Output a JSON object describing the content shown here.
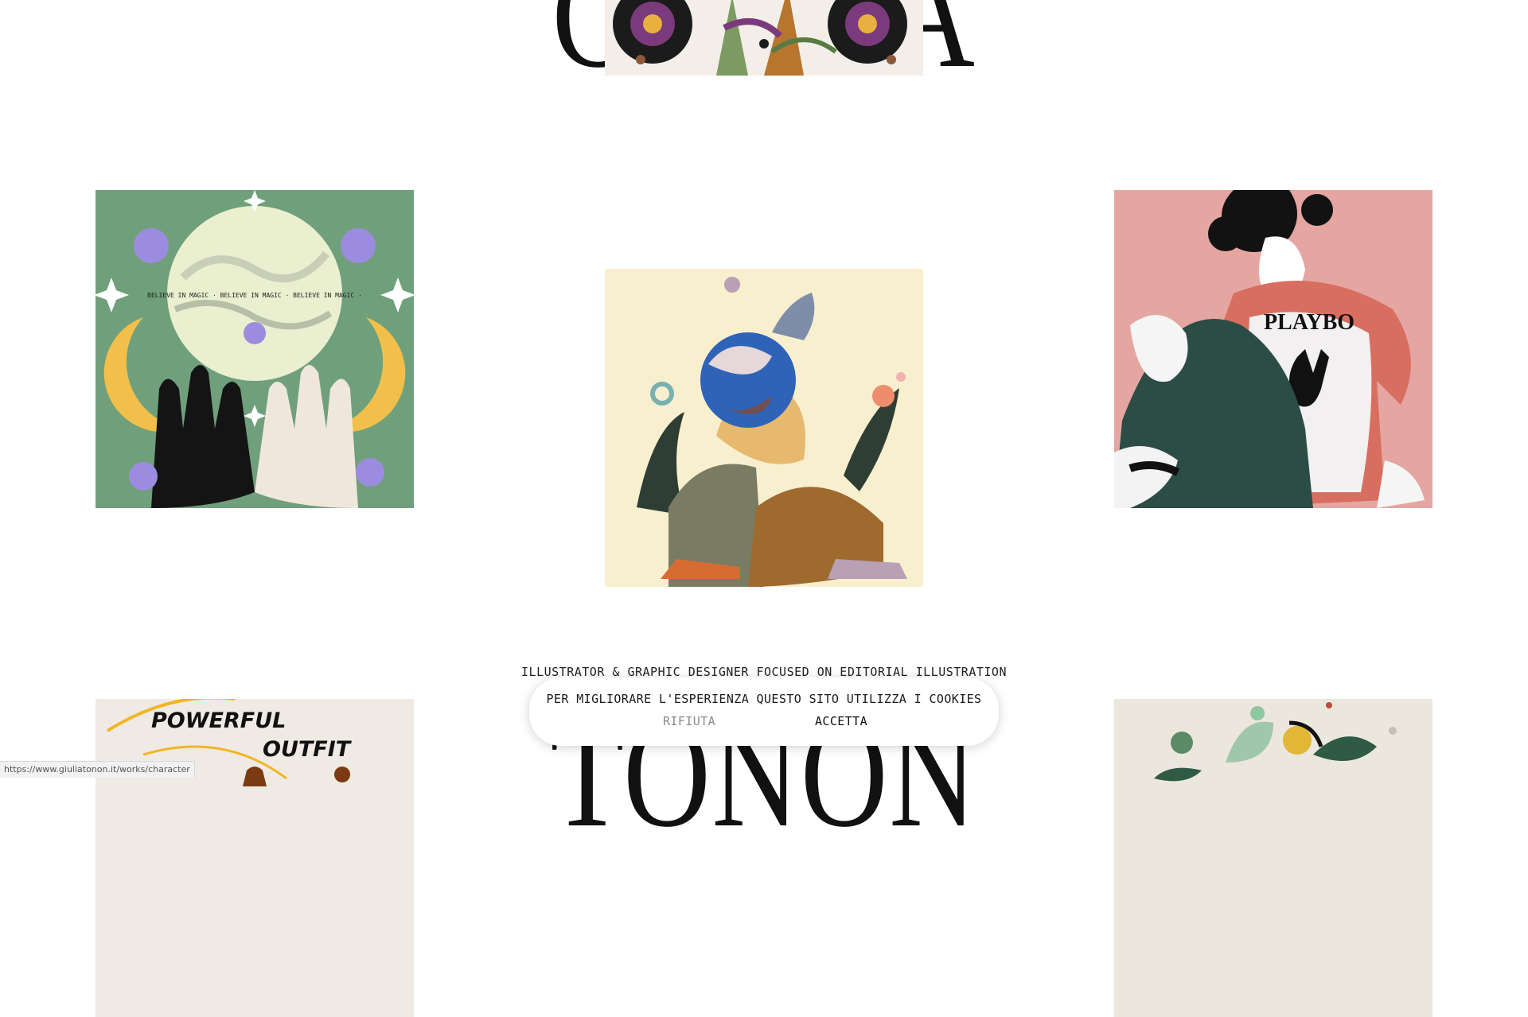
{
  "header": {
    "name_top": "GIULIA",
    "name_bottom": "TONON"
  },
  "tagline": "ILLUSTRATOR & GRAPHIC DESIGNER FOCUSED ON EDITORIAL ILLUSTRATION",
  "artworks": {
    "magic_badge_text": "BELIEVE IN MAGIC · BELIEVE IN MAGIC · BELIEVE IN MAGIC ·",
    "playboy_shirt_text": "PLAYBO",
    "outfit_line1": "POWERFUL",
    "outfit_line2": "OUTFIT"
  },
  "cookie_banner": {
    "message": "PER MIGLIORARE L'ESPERIENZA QUESTO SITO UTILIZZA I COOKIES",
    "reject_label": "RIFIUTA",
    "accept_label": "ACCETTA"
  },
  "status_bar": {
    "url": "https://www.giuliatonon.it/works/character"
  },
  "colors": {
    "background": "#ffffff",
    "magic_green": "#6fa07b",
    "friends_cream": "#f8efcf",
    "playboy_pink": "#e5a6a2",
    "outfit_beige": "#efeae3",
    "plants_beige": "#ebe7dc"
  }
}
